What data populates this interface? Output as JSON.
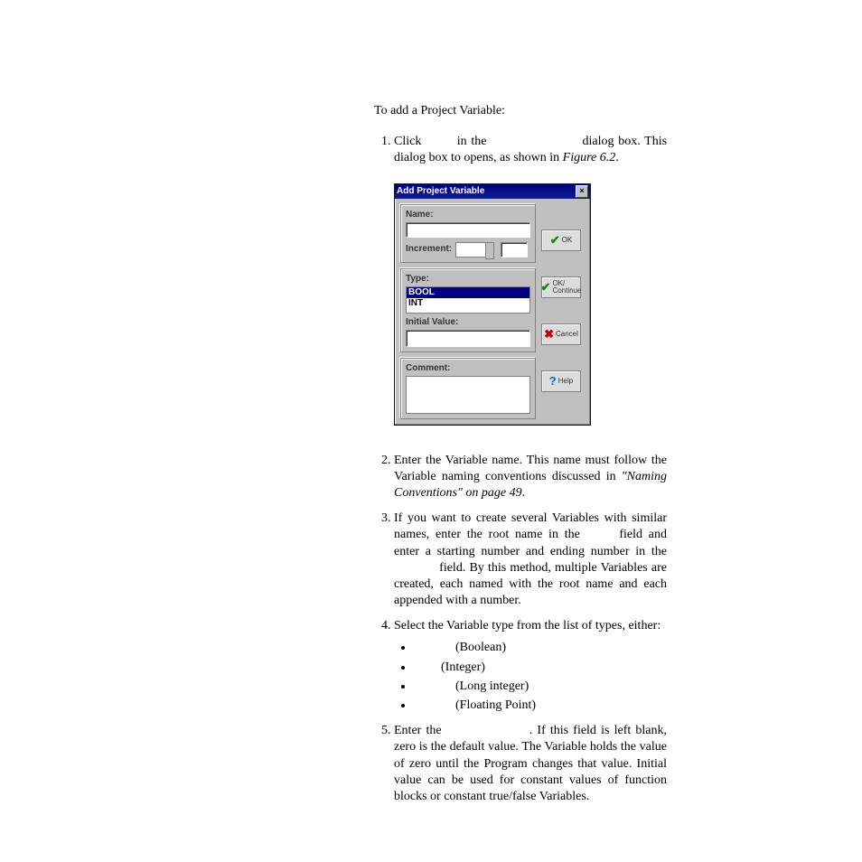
{
  "intro": "To add a Project Variable:",
  "step1_a": "Click",
  "step1_b": "in the",
  "step1_c": "dialog box. This dialog box to opens, as shown in ",
  "step1_fig": "Figure 6.2",
  "step1_end": ".",
  "dialog": {
    "title": "Add Project Variable",
    "name_label": "Name:",
    "increment_label": "Increment:",
    "type_label": "Type:",
    "type_options": {
      "sel": "BOOL",
      "opt": "INT"
    },
    "initial_label": "Initial Value:",
    "comment_label": "Comment:",
    "btn_ok": "OK",
    "btn_okcont_a": "OK/",
    "btn_okcont_b": "Continue",
    "btn_cancel": "Cancel",
    "btn_help": "Help"
  },
  "step2_a": "Enter the Variable name. This name must follow the Variable naming conventions discussed in ",
  "step2_ital": "\"Naming Conventions\" on page 49",
  "step2_end": ".",
  "step3_a": "If you want to create several Variables with similar names, enter the root name in the ",
  "step3_b": " field and enter a starting number and ending number in the ",
  "step3_c": " field. By this method, multiple Variables are created, each named with the root name and each appended with a number.",
  "step4": "Select the Variable type from the list of types, either:",
  "types": {
    "bool": "(Boolean)",
    "int": "(Integer)",
    "long": "(Long integer)",
    "float": "(Floating Point)"
  },
  "step5_a": "Enter the ",
  "step5_b": ". If this field is left blank, zero is the default value. The Variable holds the value of zero until the Program changes that value. Initial value can be used for constant values of function blocks or constant true/false Variables."
}
